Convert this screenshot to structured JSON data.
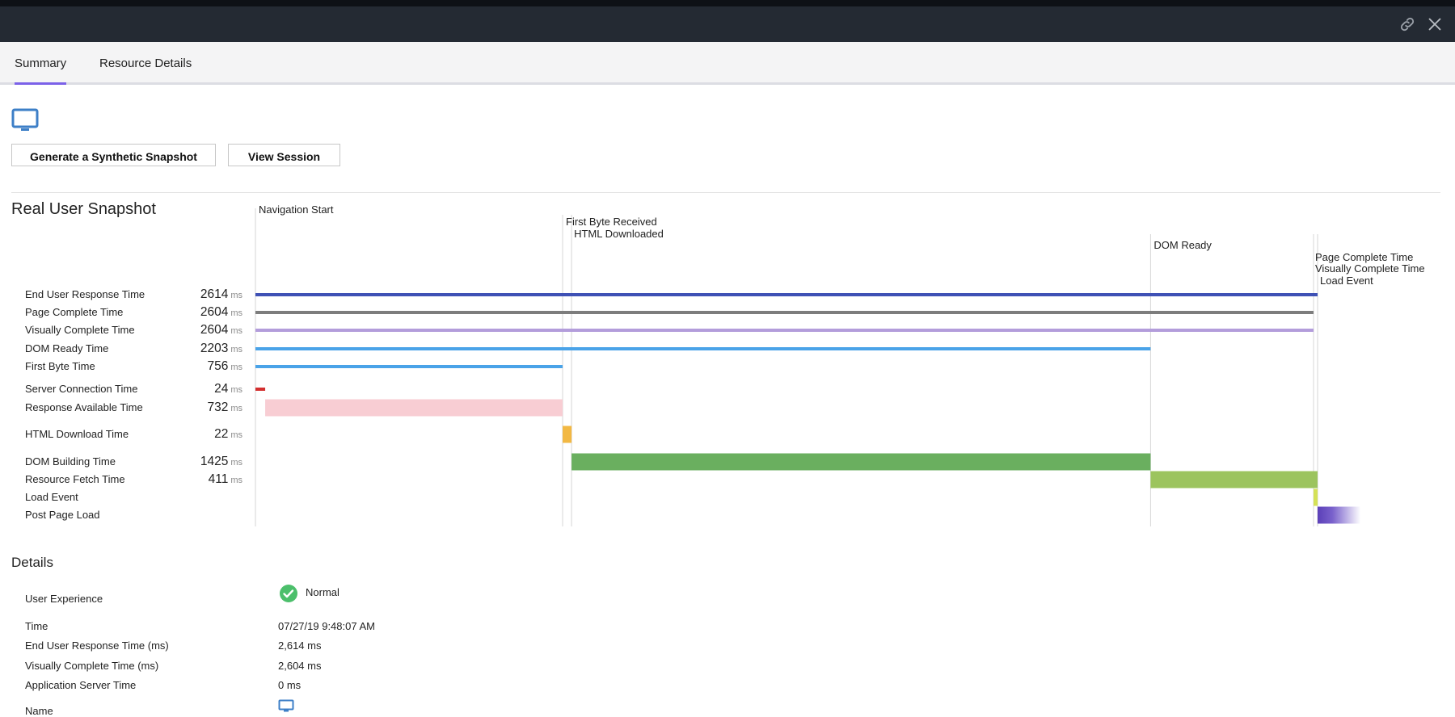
{
  "header": {
    "icons": [
      "link-icon",
      "close-icon"
    ]
  },
  "tabs": [
    {
      "label": "Summary",
      "active": true
    },
    {
      "label": "Resource Details",
      "active": false
    }
  ],
  "toolbar": {
    "icon": "monitor-icon",
    "synthetic_label": "Generate a Synthetic Snapshot",
    "view_session_label": "View Session"
  },
  "snapshot": {
    "title": "Real User Snapshot",
    "markers": [
      {
        "label": "Navigation Start",
        "time": 0
      },
      {
        "label": "First Byte Received",
        "time": 756
      },
      {
        "label": "HTML Downloaded",
        "time": 778
      },
      {
        "label": "DOM Ready",
        "time": 2203
      },
      {
        "label": "Page Complete Time",
        "time": 2604
      },
      {
        "label": "Visually Complete Time",
        "time": 2604
      },
      {
        "label": "Load Event",
        "time": 2614
      }
    ],
    "rows": [
      {
        "label": "End User Response Time",
        "value": "2614",
        "unit": "ms",
        "start": 0,
        "end": 2614,
        "color": "#3f51b5",
        "kind": "line"
      },
      {
        "label": "Page Complete Time",
        "value": "2604",
        "unit": "ms",
        "start": 0,
        "end": 2604,
        "color": "#7d7d7d",
        "kind": "line"
      },
      {
        "label": "Visually Complete Time",
        "value": "2604",
        "unit": "ms",
        "start": 0,
        "end": 2604,
        "color": "#b39ddb",
        "kind": "line"
      },
      {
        "label": "DOM Ready Time",
        "value": "2203",
        "unit": "ms",
        "start": 0,
        "end": 2203,
        "color": "#4aa3e8",
        "kind": "line"
      },
      {
        "label": "First Byte Time",
        "value": "756",
        "unit": "ms",
        "start": 0,
        "end": 756,
        "color": "#4aa3e8",
        "kind": "line"
      },
      {
        "label": "Server Connection Time",
        "value": "24",
        "unit": "ms",
        "start": 0,
        "end": 24,
        "color": "#d32f2f",
        "kind": "thin"
      },
      {
        "label": "Response Available Time",
        "value": "732",
        "unit": "ms",
        "start": 24,
        "end": 756,
        "color": "#f8cdd3",
        "kind": "bar"
      },
      {
        "label": "HTML Download Time",
        "value": "22",
        "unit": "ms",
        "start": 756,
        "end": 778,
        "color": "#f2b843",
        "kind": "bar"
      },
      {
        "label": "DOM Building Time",
        "value": "1425",
        "unit": "ms",
        "start": 778,
        "end": 2203,
        "color": "#6aaf5f",
        "kind": "bar"
      },
      {
        "label": "Resource Fetch Time",
        "value": "411",
        "unit": "ms",
        "start": 2203,
        "end": 2614,
        "color": "#9cc45e",
        "kind": "bar"
      },
      {
        "label": "Load Event",
        "value": "",
        "unit": "",
        "start": 2604,
        "end": 2614,
        "color": "#d4e157",
        "kind": "bar"
      },
      {
        "label": "Post Page Load",
        "value": "",
        "unit": "",
        "start": 2614,
        "end": 2720,
        "color": "#6a4fc4",
        "kind": "fade"
      }
    ]
  },
  "details": {
    "title": "Details",
    "rows": [
      {
        "label": "User Experience",
        "value": "Normal",
        "icon": "check-icon"
      },
      {
        "label": "Time",
        "value": "07/27/19 9:48:07 AM"
      },
      {
        "label": "End User Response Time (ms)",
        "value": "2,614 ms"
      },
      {
        "label": "Visually Complete Time (ms)",
        "value": "2,604 ms"
      },
      {
        "label": "Application Server Time",
        "value": "0 ms"
      },
      {
        "label": "Name",
        "value": "",
        "icon": "monitor-icon"
      }
    ]
  }
}
